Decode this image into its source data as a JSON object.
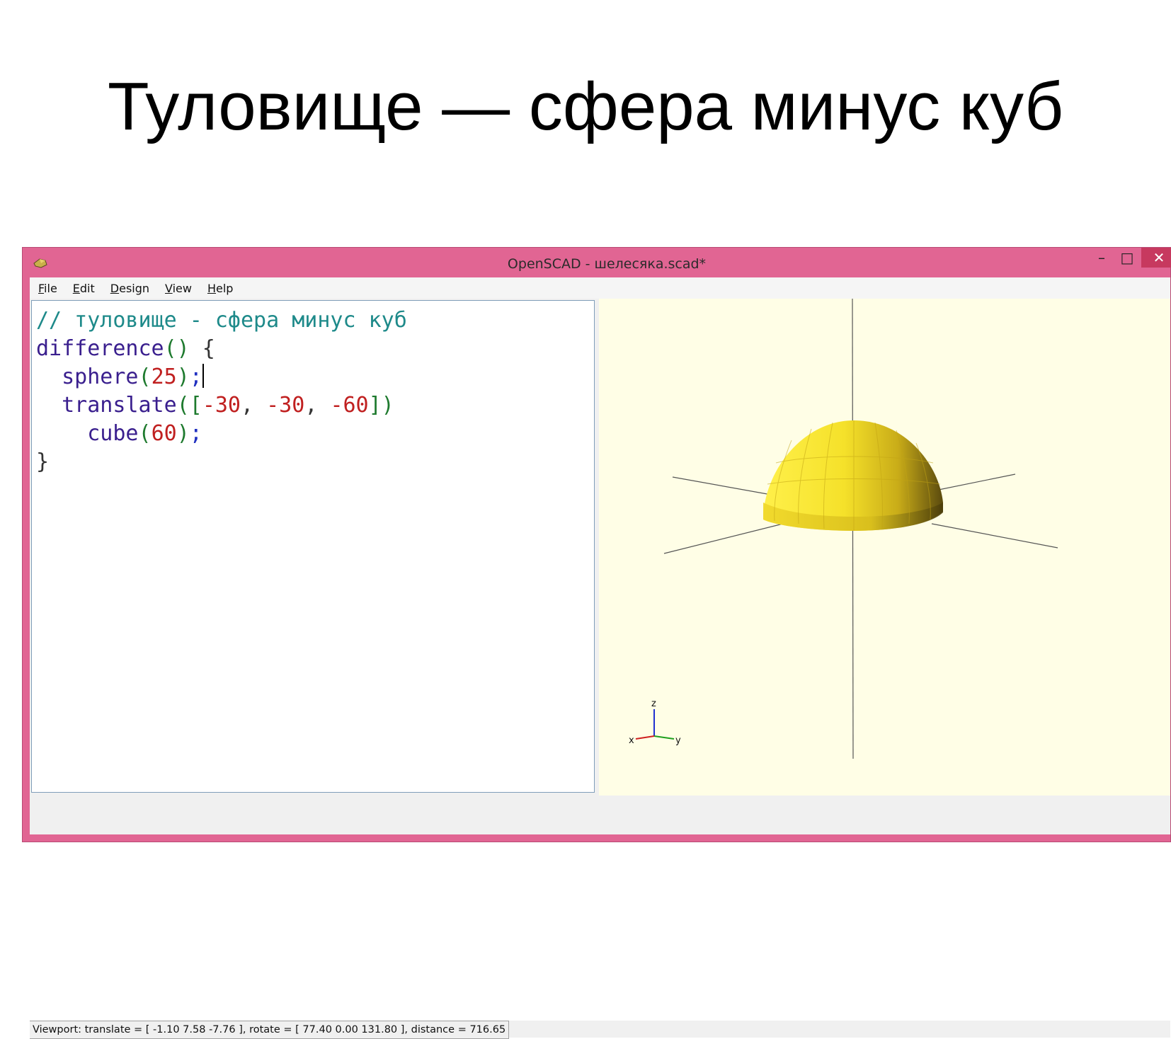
{
  "slide": {
    "title": "Туловище — сфера минус куб"
  },
  "window": {
    "title": "OpenSCAD - шелесяка.scad*",
    "min_glyph": "–",
    "max_glyph": "□",
    "close_glyph": "✕"
  },
  "menu": {
    "items": [
      "File",
      "Edit",
      "Design",
      "View",
      "Help"
    ]
  },
  "editor": {
    "lines": [
      [
        {
          "t": "// туловище - сфера минус куб",
          "c": "comment"
        }
      ],
      [
        {
          "t": "difference",
          "c": "fn"
        },
        {
          "t": "()",
          "c": "punc"
        },
        {
          "t": " {",
          "c": "brace"
        }
      ],
      [
        {
          "t": "  sphere",
          "c": "fn"
        },
        {
          "t": "(",
          "c": "punc"
        },
        {
          "t": "25",
          "c": "num"
        },
        {
          "t": ")",
          "c": "punc"
        },
        {
          "t": ";",
          "c": "semi"
        }
      ],
      [
        {
          "t": "  translate",
          "c": "fn"
        },
        {
          "t": "([",
          "c": "punc"
        },
        {
          "t": "-30",
          "c": "num"
        },
        {
          "t": ", ",
          "c": "brace"
        },
        {
          "t": "-30",
          "c": "num"
        },
        {
          "t": ", ",
          "c": "brace"
        },
        {
          "t": "-60",
          "c": "num"
        },
        {
          "t": "])",
          "c": "punc"
        }
      ],
      [
        {
          "t": "    cube",
          "c": "fn"
        },
        {
          "t": "(",
          "c": "punc"
        },
        {
          "t": "60",
          "c": "num"
        },
        {
          "t": ")",
          "c": "punc"
        },
        {
          "t": ";",
          "c": "semi"
        }
      ],
      [
        {
          "t": "}",
          "c": "brace"
        }
      ]
    ],
    "caret_line": 2
  },
  "viewport": {
    "axis_labels": {
      "z": "z",
      "x": "x",
      "y": "y"
    },
    "background": "#fffee6",
    "model_color": "#f5e12a"
  },
  "status": {
    "text": "Viewport: translate = [ -1.10 7.58 -7.76 ], rotate = [ 77.40 0.00 131.80 ], distance = 716.65"
  },
  "colors": {
    "window_frame": "#e16593",
    "close_button": "#c7395f"
  }
}
